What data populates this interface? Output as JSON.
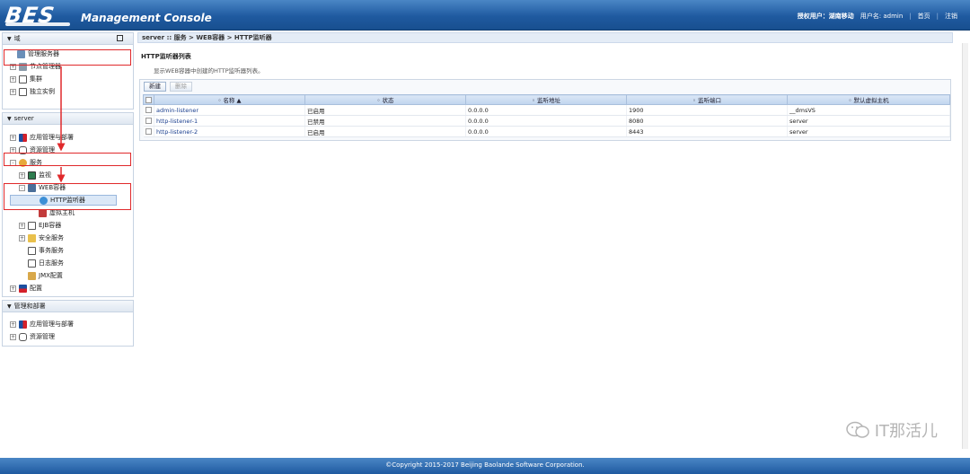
{
  "header": {
    "logo": "BES",
    "title": "Management Console",
    "licensee_label": "授权用户：",
    "licensee": "湖南移动",
    "user_label": "用户名: admin",
    "home": "首页",
    "logout": "注销"
  },
  "left": {
    "domain_section": {
      "title": "域",
      "items": [
        "管理服务器",
        "节点管理器",
        "集群",
        "独立实例"
      ]
    },
    "server_section": {
      "title": "server",
      "items": {
        "app_deploy": "应用管理与部署",
        "resource": "资源管理",
        "services": "服务",
        "monitor": "监视",
        "web_container": "WEB容器",
        "http_listener": "HTTP监听器",
        "virtual_host": "虚拟主机",
        "ejb": "EJB容器",
        "security": "安全服务",
        "transaction": "事务服务",
        "log": "日志服务",
        "jmx": "JMX配置",
        "config": "配置"
      }
    },
    "manage_section": {
      "title": "管理和部署",
      "items": [
        "应用管理与部署",
        "资源管理"
      ]
    }
  },
  "main": {
    "breadcrumb": "server :: 服务 > WEB容器 > HTTP监听器",
    "title": "HTTP监听器列表",
    "description": "显示WEB容器中创建的HTTP监听器列表。",
    "toolbar": {
      "new": "新建",
      "delete": "删除"
    },
    "columns": [
      "名称 ▲",
      "状态",
      "监听地址",
      "监听端口",
      "默认虚拟主机"
    ],
    "rows": [
      {
        "name": "admin-listener",
        "status": "已启用",
        "address": "0.0.0.0",
        "port": "1900",
        "vhost": "__dmsVS"
      },
      {
        "name": "http-listener-1",
        "status": "已禁用",
        "address": "0.0.0.0",
        "port": "8080",
        "vhost": "server"
      },
      {
        "name": "http-listener-2",
        "status": "已启用",
        "address": "0.0.0.0",
        "port": "8443",
        "vhost": "server"
      }
    ]
  },
  "watermark": "IT那活儿",
  "footer": "©Copyright 2015-2017 Beijing Baolande Software Corporation.",
  "colors": {
    "header": "#1f5aa0",
    "highlight": "#e0292b"
  }
}
